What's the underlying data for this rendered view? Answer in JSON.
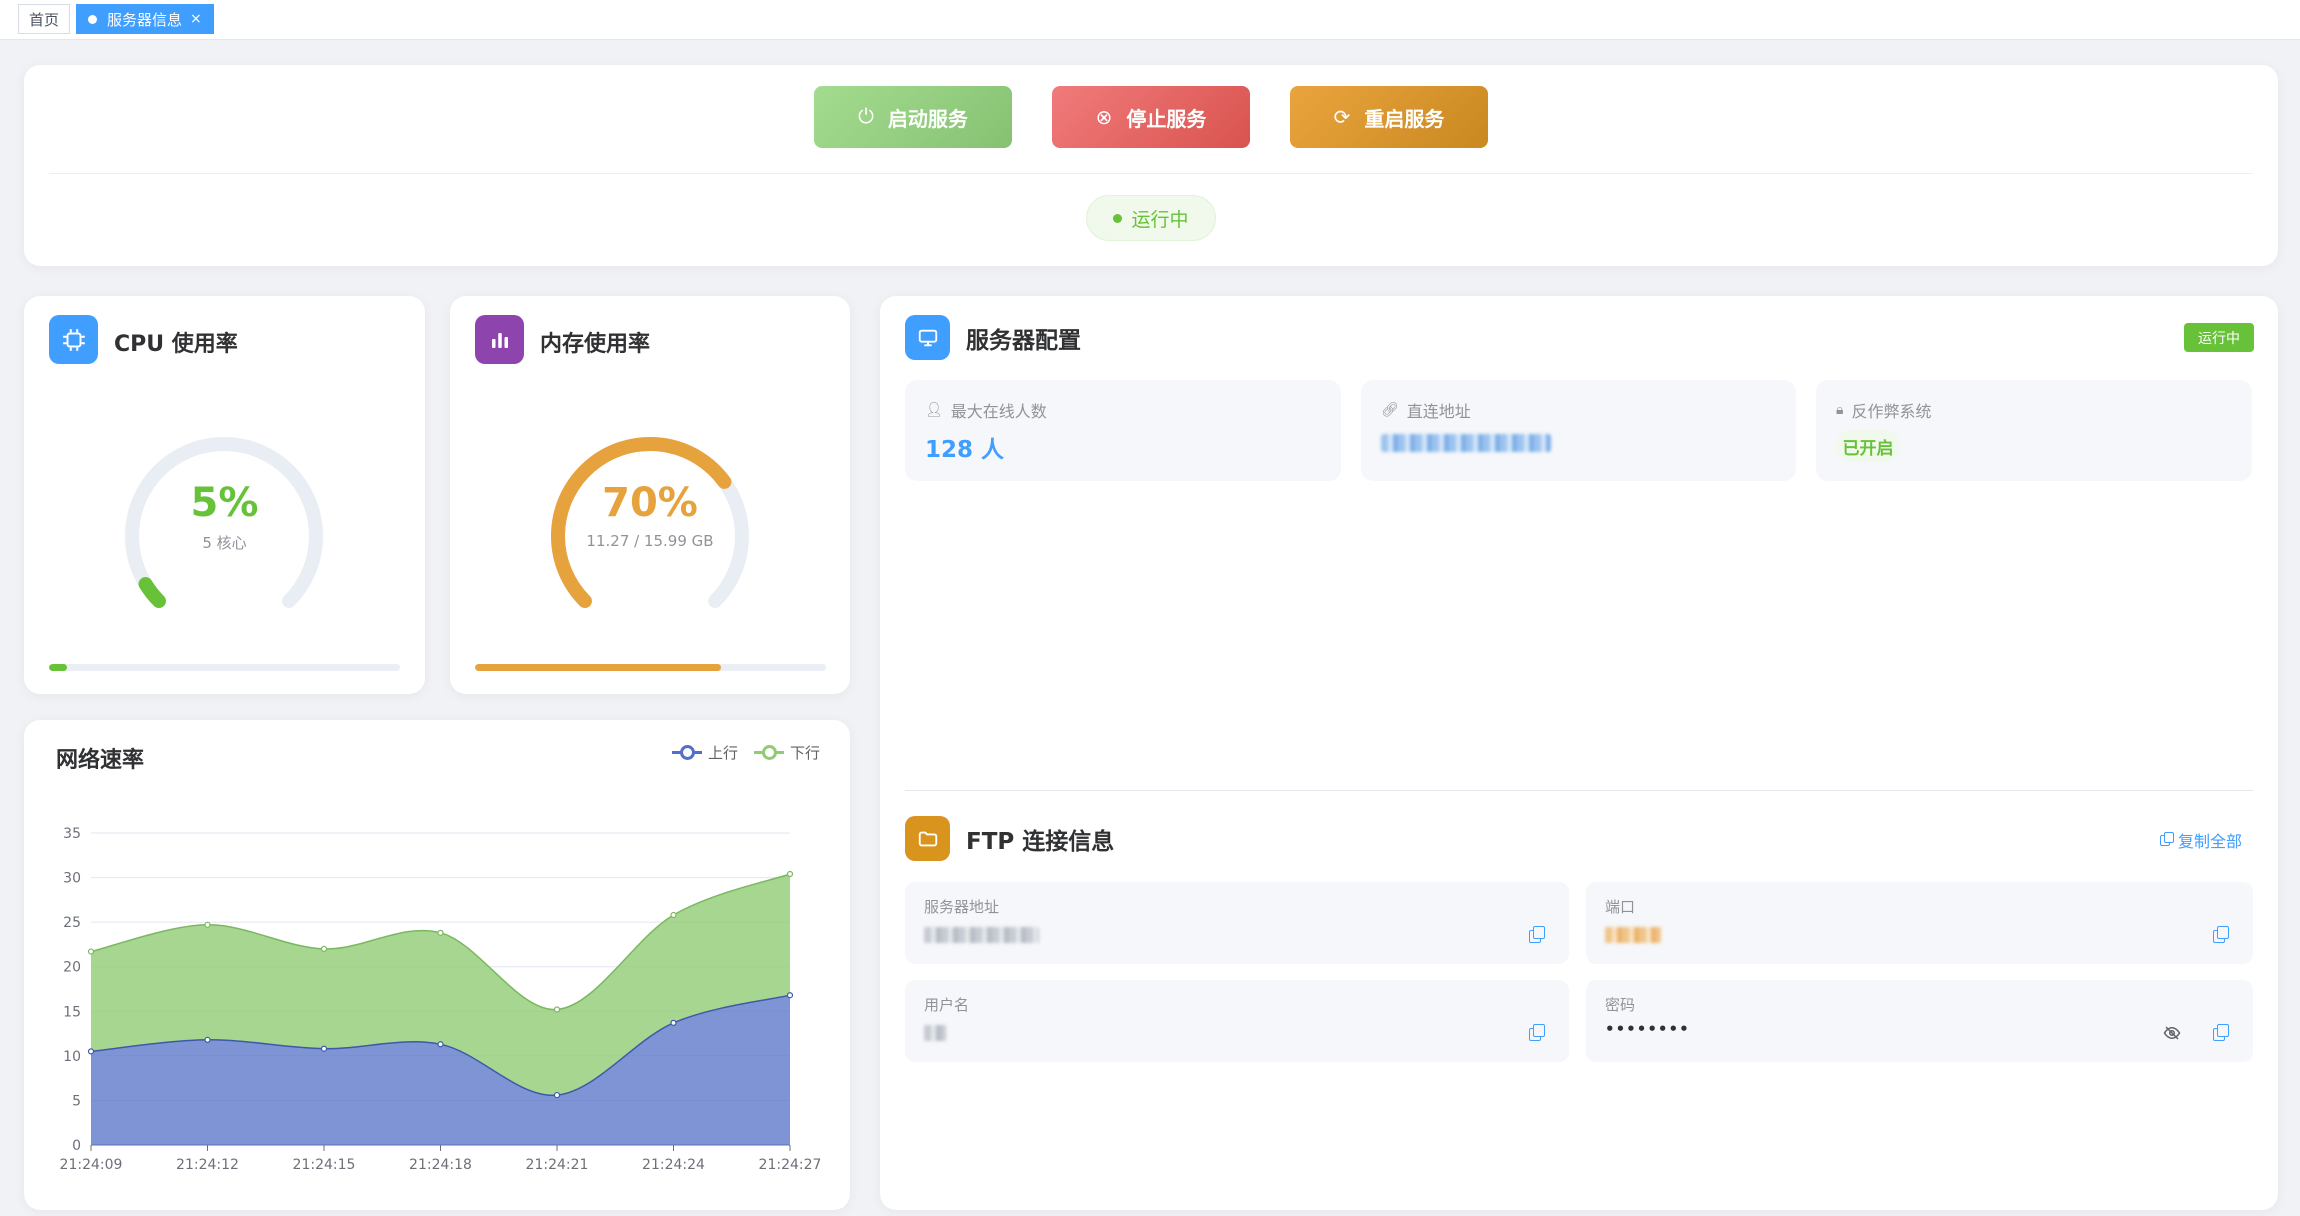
{
  "tabs": [
    {
      "label": "首页",
      "active": false
    },
    {
      "label": "服务器信息",
      "active": true,
      "close": "×"
    }
  ],
  "controls": {
    "start_label": "启动服务",
    "stop_label": "停止服务",
    "restart_label": "重启服务",
    "status": "运行中"
  },
  "cpu": {
    "title": "CPU 使用率",
    "value": "5%",
    "sub": "5 核心",
    "percent": 5,
    "color": "#67c23a"
  },
  "memory": {
    "title": "内存使用率",
    "value": "70%",
    "sub": "11.27 / 15.99 GB",
    "percent": 70,
    "color": "#e6a23c"
  },
  "network": {
    "title": "网络速率",
    "legend": [
      "上行",
      "下行"
    ],
    "colors": {
      "up": "#5470c6",
      "down": "#91cc75"
    }
  },
  "chart_data": {
    "type": "area",
    "x": [
      "21:24:09",
      "21:24:10",
      "21:24:11",
      "21:24:12",
      "21:24:13",
      "21:24:14",
      "21:24:15",
      "21:24:16",
      "21:24:17",
      "21:24:18",
      "21:24:19",
      "21:24:20",
      "21:24:21",
      "21:24:22",
      "21:24:23",
      "21:24:24",
      "21:24:25",
      "21:24:26",
      "21:24:27"
    ],
    "tick_labels": [
      "21:24:09",
      "21:24:12",
      "21:24:15",
      "21:24:18",
      "21:24:21",
      "21:24:24",
      "21:24:27"
    ],
    "stacked": true,
    "series": [
      {
        "name": "上行",
        "values": [
          10.5,
          null,
          null,
          11.8,
          null,
          null,
          10.8,
          null,
          null,
          11.3,
          null,
          null,
          5.6,
          null,
          null,
          13.7,
          null,
          null,
          16.8
        ]
      },
      {
        "name": "下行",
        "values": [
          11.2,
          null,
          null,
          12.9,
          null,
          null,
          11.2,
          null,
          null,
          12.5,
          null,
          null,
          9.6,
          null,
          null,
          12.1,
          null,
          null,
          13.6
        ]
      }
    ],
    "ylim": [
      0,
      35
    ],
    "yticks": [
      0,
      5,
      10,
      15,
      20,
      25,
      30,
      35
    ],
    "grid": true,
    "legend_position": "top-right"
  },
  "server": {
    "title": "服务器配置",
    "badge": "运行中",
    "max_online_label": "最大在线人数",
    "max_online_value": "128 人",
    "direct_addr_label": "直连地址",
    "anticheat_label": "反作弊系统",
    "anticheat_value": "已开启"
  },
  "ftp": {
    "title": "FTP 连接信息",
    "copy_all": "复制全部",
    "host_label": "服务器地址",
    "port_label": "端口",
    "user_label": "用户名",
    "password_label": "密码",
    "password_value": "••••••••"
  }
}
